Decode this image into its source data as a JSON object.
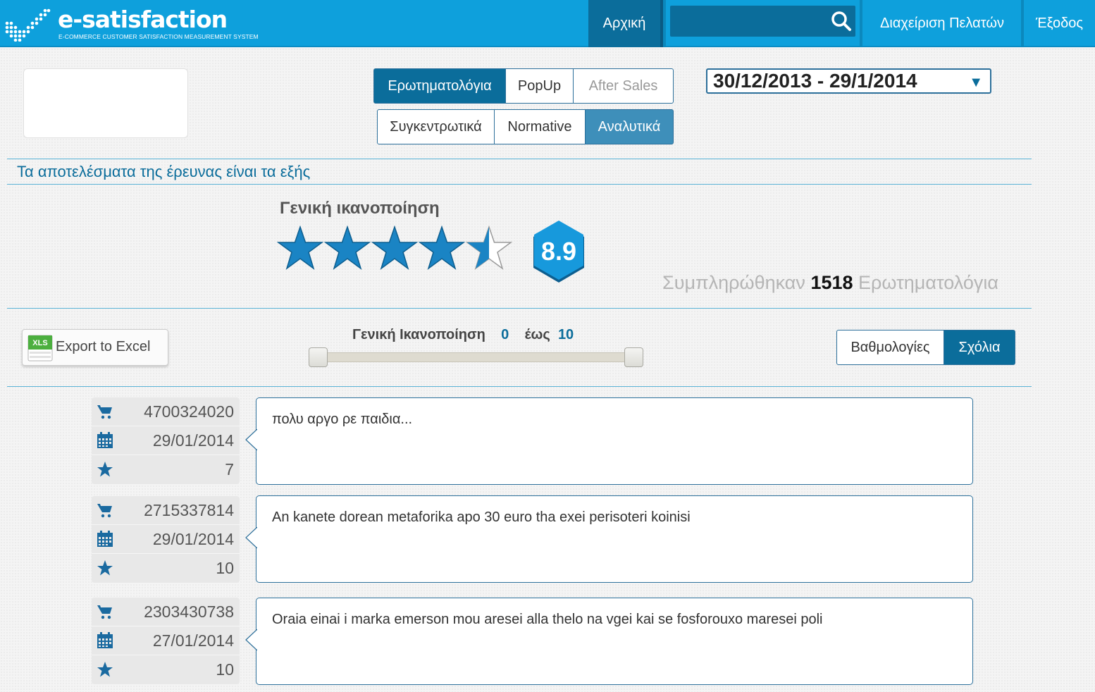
{
  "header": {
    "logo_title": "e-satisfaction",
    "logo_subtitle": "E-COMMERCE CUSTOMER SATISFACTION MEASUREMENT SYSTEM",
    "nav_home": "Αρχική",
    "search_value": "",
    "nav_customers": "Διαχείριση Πελατών",
    "nav_logout": "Έξοδος",
    "accent_color": "#0ea0dc"
  },
  "source_tabs": [
    "Ερωτηματολόγια",
    "PopUp",
    "After Sales"
  ],
  "view_tabs": [
    "Συγκεντρωτικά",
    "Normative",
    "Αναλυτικά"
  ],
  "date_range": "30/12/2013 - 29/1/2014",
  "results_title": "Τα αποτελέσματα της έρευνας είναι τα εξής",
  "overall": {
    "title": "Γενική ικανοποίηση",
    "stars_value": 4.5,
    "stars_max": 5,
    "score": "8.9",
    "completed_prefix": "Συμπληρώθηκαν",
    "completed_count": "1518",
    "completed_suffix": "Ερωτηματολόγια"
  },
  "filter": {
    "export_label": "Export to Excel",
    "xls_badge": "XLS",
    "range_label": "Γενική Ικανοποίηση",
    "range_min": "0",
    "range_to": "έως",
    "range_max": "10",
    "view_toggle": [
      "Βαθμολογίες",
      "Σχόλια"
    ]
  },
  "comments": [
    {
      "order_id": "4700324020",
      "date": "29/01/2014",
      "rating": "7",
      "text": "πολυ αργο ρε παιδια..."
    },
    {
      "order_id": "2715337814",
      "date": "29/01/2014",
      "rating": "10",
      "text": "An kanete dorean metaforika apo 30 euro tha exei perisoteri koinisi"
    },
    {
      "order_id": "2303430738",
      "date": "27/01/2014",
      "rating": "10",
      "text": "Oraia einai i marka emerson mou aresei alla thelo na vgei kai se fosforouxo maresei poli"
    }
  ]
}
